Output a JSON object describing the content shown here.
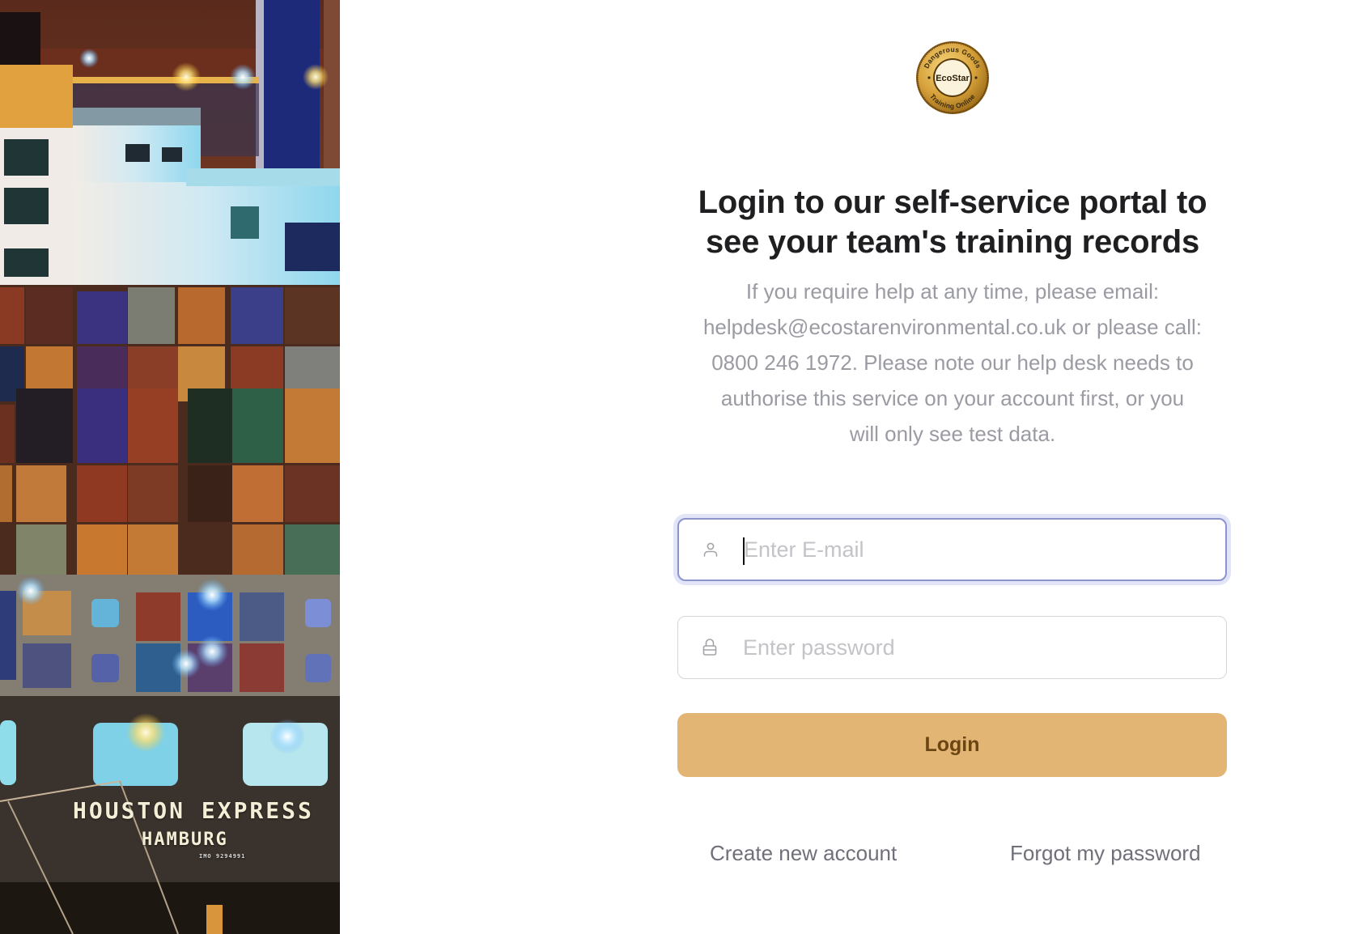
{
  "hero": {
    "alt": "Container ship at night",
    "ship_name": "HOUSTON EXPRESS",
    "home_port": "HAMBURG",
    "imo_label": "IMO 9294991"
  },
  "logo": {
    "name": "EcoStar",
    "ring_top_text": "Dangerous Goods",
    "ring_bottom_text": "Training Online",
    "gold_color": "#c9962b",
    "dark_color": "#3a2a10"
  },
  "heading": {
    "line1": "Login to our self-service portal to",
    "line2": "see your team's training records"
  },
  "help_text": {
    "lines": [
      "If you require help at any time, please email:",
      "helpdesk@ecostarenvironmental.co.uk or please call:",
      "0800 246 1972. Please note our help desk needs to",
      "authorise this service on your account first, or you",
      "will only see test data."
    ]
  },
  "form": {
    "email": {
      "value": "",
      "placeholder": "Enter E-mail",
      "icon": "user-icon",
      "focused": true
    },
    "password": {
      "value": "",
      "placeholder": "Enter password",
      "icon": "lock-icon"
    },
    "login_label": "Login",
    "login_color": "#e3b574",
    "login_text_color": "#6b4512",
    "focus_ring_color": "#8d94cc"
  },
  "links": {
    "create_account": "Create new account",
    "forgot_password": "Forgot my password"
  }
}
